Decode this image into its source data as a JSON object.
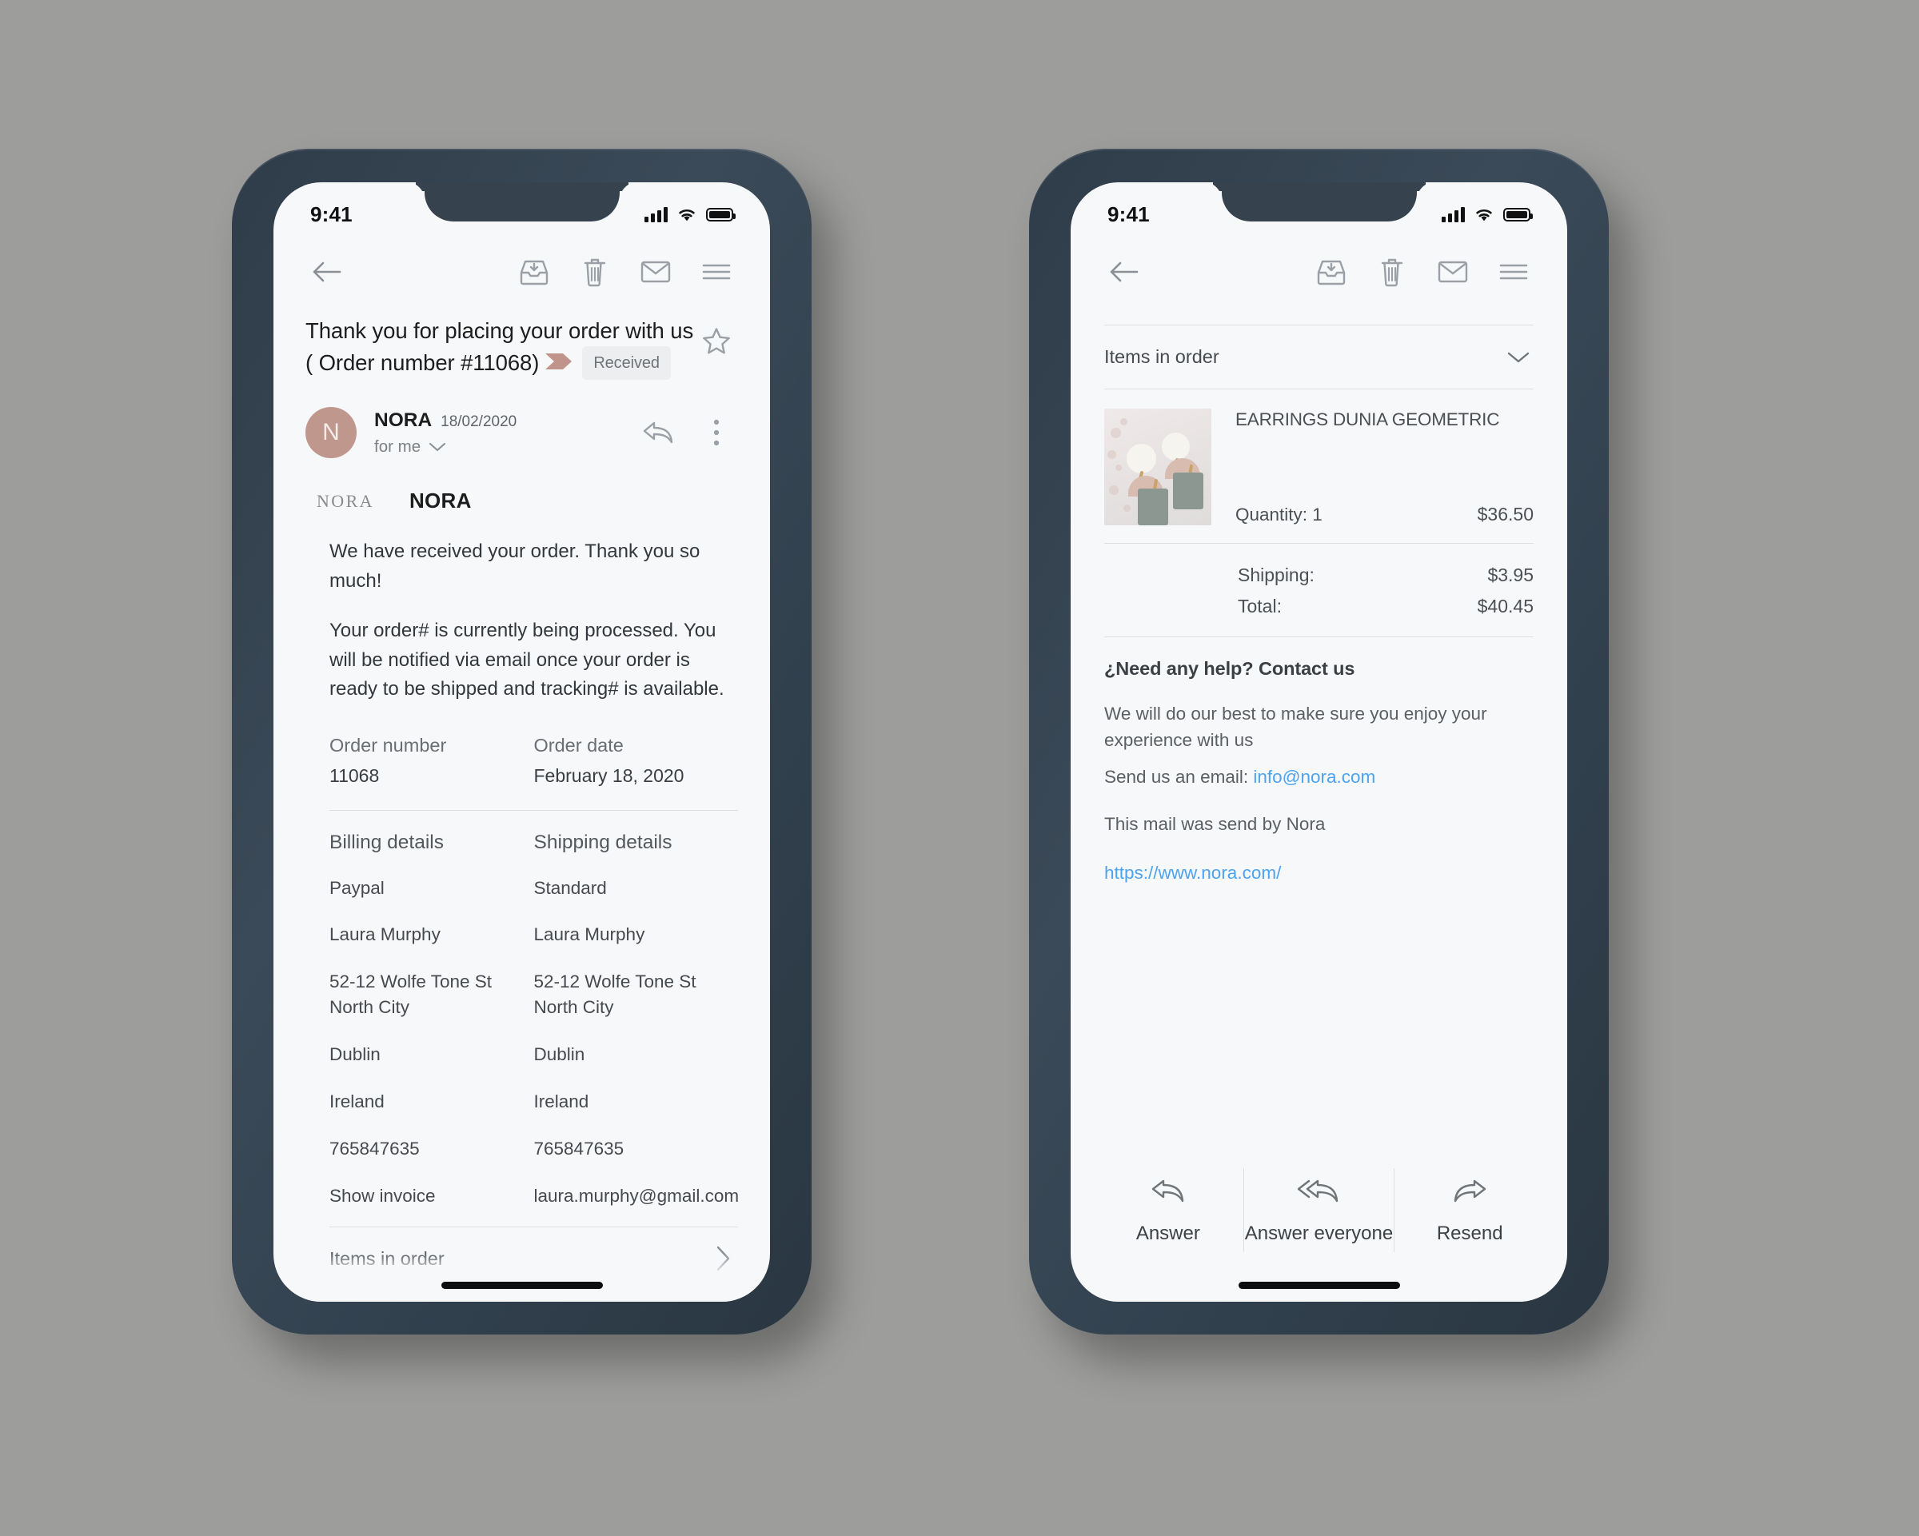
{
  "status_bar": {
    "time": "9:41"
  },
  "toolbar": {
    "back_icon": "back-arrow-icon",
    "archive_icon": "archive-inbox-icon",
    "delete_icon": "trash-icon",
    "unread_icon": "envelope-icon",
    "menu_icon": "hamburger-menu-icon"
  },
  "phone1": {
    "subject": "Thank you for placing your order with us ( Order number #11068)",
    "status_badge": "Received",
    "star_icon": "star-outline-icon",
    "sender": {
      "avatar_letter": "N",
      "name": "NORA",
      "date": "18/02/2020",
      "recipients": "for me",
      "reply_icon": "reply-arrow-icon",
      "more_icon": "more-vertical-icon"
    },
    "brand": {
      "logo": "NORA",
      "name": "NORA"
    },
    "body": [
      "We have received your order. Thank you so much!",
      "Your order# is currently being processed. You will be notified via email once your order is ready to be shipped and tracking# is available."
    ],
    "order_meta": [
      {
        "label": "Order number",
        "value": "11068"
      },
      {
        "label": "Order date",
        "value": "February 18, 2020"
      }
    ],
    "details_headers": [
      "Billing details",
      "Shipping details"
    ],
    "details_rows": [
      [
        "Paypal",
        "Standard"
      ],
      [
        "Laura Murphy",
        "Laura Murphy"
      ],
      [
        "52-12 Wolfe Tone St North City",
        "52-12 Wolfe Tone St North City"
      ],
      [
        "Dublin",
        "Dublin"
      ],
      [
        "Ireland",
        "Ireland"
      ],
      [
        "765847635",
        "765847635"
      ]
    ],
    "invoice_link": "Show invoice",
    "email_link": "laura.murphy@gmail.com",
    "items_bar": {
      "label": "Items in order",
      "icon": "chevron-right-icon"
    }
  },
  "phone2": {
    "accordion": {
      "label": "Items in order",
      "icon": "chevron-down-icon"
    },
    "product": {
      "image_alt": "earrings-product-photo",
      "title": "EARRINGS DUNIA GEOMETRIC",
      "quantity": "Quantity: 1",
      "price": "$36.50"
    },
    "totals": [
      {
        "label": "Shipping:",
        "value": "$3.95"
      },
      {
        "label": "Total:",
        "value": "$40.45"
      }
    ],
    "help_heading": "¿Need any help? Contact us",
    "help_text": "We will do our best to make sure you enjoy your experience with us",
    "email_prefix": "Send us an email: ",
    "email_link": "info@nora.com",
    "sent_by": "This mail was send by Nora",
    "website_url": "https://www.nora.com/",
    "footer": [
      {
        "label": "Answer",
        "icon": "reply-arrow-icon"
      },
      {
        "label": "Answer everyone",
        "icon": "reply-all-arrow-icon"
      },
      {
        "label": "Resend",
        "icon": "forward-arrow-icon"
      }
    ]
  },
  "colors": {
    "background": "#9d9d9c",
    "frame": "#36434f",
    "screen": "#f7f8f9",
    "accent_rose": "#c0978d",
    "link_blue": "#4ca3f0",
    "badge_bg": "#eceef0"
  }
}
